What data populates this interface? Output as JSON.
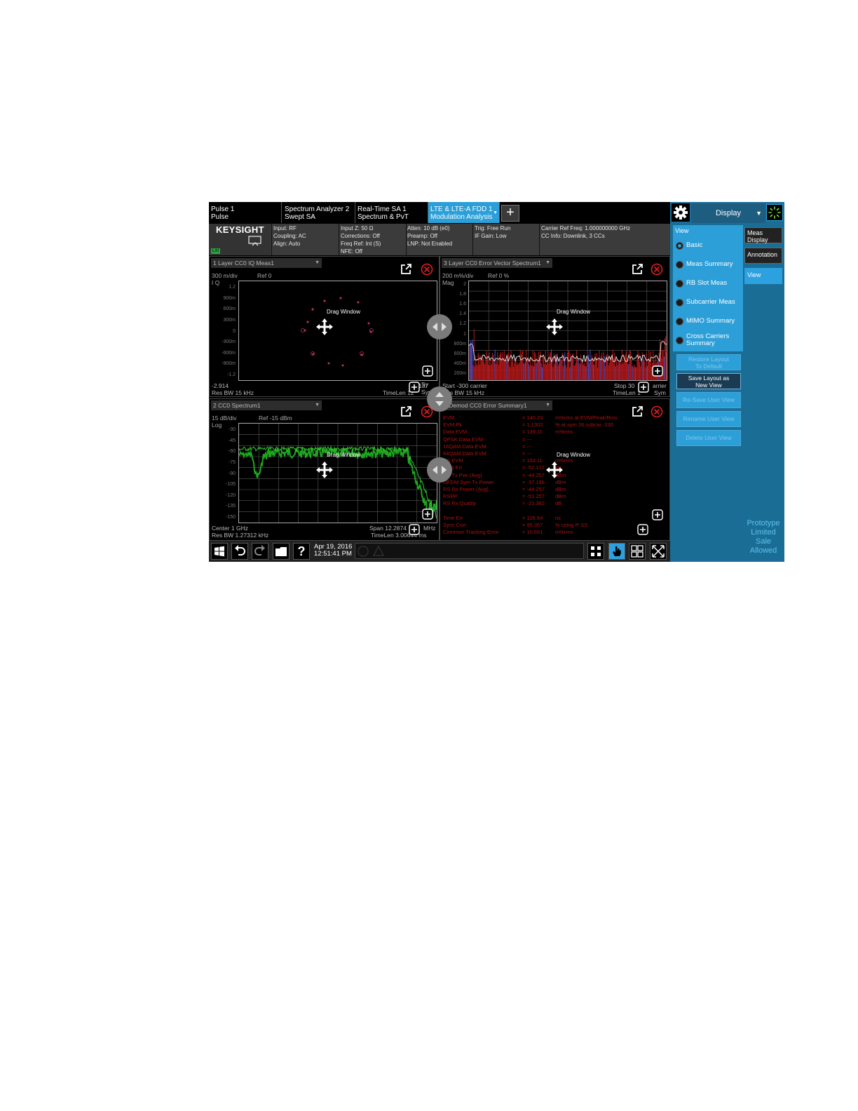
{
  "tabs": [
    {
      "line1": "Pulse 1",
      "line2": "Pulse"
    },
    {
      "line1": "Spectrum Analyzer 2",
      "line2": "Swept SA"
    },
    {
      "line1": "Real-Time SA 1",
      "line2": "Spectrum & PvT"
    },
    {
      "line1": "LTE & LTE-A FDD 1",
      "line2": "Modulation Analysis"
    }
  ],
  "add_tab_label": "+",
  "menu": {
    "label": "Display"
  },
  "brand": "KEYSIGHT",
  "lxi_badge": "LXI",
  "info": {
    "col1": [
      "Input: RF",
      "Coupling: AC",
      "Align: Auto"
    ],
    "col2": [
      "Input Z: 50 Ω",
      "Corrections: Off",
      "Freq Ref: Int (S)",
      "NFE: Off"
    ],
    "col3": [
      "Atten: 10 dB (e0)",
      "Preamp: Off",
      "LNP: Not Enabled"
    ],
    "col4": [
      "Trig: Free Run",
      "IF Gain: Low"
    ],
    "col5": [
      "Carrier Ref Freq: 1.000000000 GHz",
      "CC Info: Downlink, 3 CCs"
    ]
  },
  "drag_label": "Drag Window",
  "windows": {
    "w1": {
      "title": "1 Layer CC0 IQ Meas1",
      "scale_left": "300 m/div",
      "scale_ref": "Ref 0",
      "scale_unit": "I Q",
      "yticks": [
        "1.2",
        "900m",
        "600m",
        "300m",
        "0",
        "-300m",
        "-600m",
        "-900m",
        "-1.2"
      ],
      "foot_left1": "-2.914",
      "foot_left2": "Res BW 15 kHz",
      "foot_right1": "137",
      "foot_right2": "TimeLen 12"
    },
    "w2": {
      "title": "2 CC0 Spectrum1",
      "scale_left": "15 dB/div",
      "scale_ref": "Ref -15 dBm",
      "scale_unit": "Log",
      "yticks": [
        "-30",
        "-45",
        "-60",
        "-75",
        "-90",
        "-105",
        "-120",
        "-135",
        "-150"
      ],
      "foot_left1": "Center 1 GHz",
      "foot_left2": "Res BW 1.27312 kHz",
      "foot_right1": "Span 12.2874",
      "foot_right2": "TimeLen 3.00644 ms",
      "foot_mhz": "MHz"
    },
    "w3": {
      "title": "3 Layer CC0 Error Vector Spectrum1",
      "scale_left": "200 m%/div",
      "scale_ref": "Ref 0 %",
      "scale_unit": "Mag",
      "yticks": [
        "2",
        "1.8",
        "1.6",
        "1.4",
        "1.2",
        "1",
        "800m",
        "600m",
        "400m",
        "200m"
      ],
      "foot_left1": "Start -300 carrier",
      "foot_left2": "Res BW 15 kHz",
      "foot_right1": "Stop 30",
      "foot_right1b": "arrier",
      "foot_right2": "TimeLen 1",
      "foot_right2b": "Sym",
      "foot_mid1": "Sy",
      "foot_mid2": "Sym"
    },
    "w4": {
      "title": "4 Demod CC0 Error Summary1",
      "rows": [
        {
          "name": "EVM",
          "v": "= 140.23",
          "u": "m%rms at  EVM/Peak/Rms"
        },
        {
          "name": "EVM Pk",
          "v": "= 1.1302",
          "u": "% at  sym 26  subcar -230"
        },
        {
          "name": "Data EVM",
          "v": "= 139.11",
          "u": "m%rms"
        },
        {
          "name": "  QPSK Data EVM",
          "v": "= ---",
          "u": ""
        },
        {
          "name": "  16QAM Data EVM",
          "v": "= ---",
          "u": ""
        },
        {
          "name": "  64QAM Data EVM",
          "v": "= ---",
          "u": ""
        },
        {
          "name": "RS EVM",
          "v": "= 153.11",
          "u": "m%rms"
        },
        {
          "name": "Freq Err",
          "v": "= -52.172",
          "u": "Hz"
        },
        {
          "name": "RS Tx Pwr (Avg)",
          "v": "= -44.257",
          "u": "dBm"
        },
        {
          "name": "OFDM Sym Tx Power",
          "v": "= -37.196",
          "u": "dBm"
        },
        {
          "name": "RS Rx Power (Avg)",
          "v": "= -44.257",
          "u": "dBm"
        },
        {
          "name": "RSRP",
          "v": "= -51.257",
          "u": "dBm"
        },
        {
          "name": "RS Rx Quality",
          "v": "= -21.382",
          "u": "dB"
        },
        {
          "name": "",
          "v": "",
          "u": ""
        },
        {
          "name": "Time Err",
          "v": "= 126.54",
          "u": "ns"
        },
        {
          "name": "Sync Corr",
          "v": "= 95.357",
          "u": "%  using  P-SS"
        },
        {
          "name": "Common Tracking Error",
          "v": "= 10.651",
          "u": "m%rms"
        }
      ]
    }
  },
  "view_panel": {
    "label": "View",
    "options": [
      "Basic",
      "Meas Summary",
      "RB Slot Meas",
      "Subcarrier Meas",
      "MIMO Summary",
      "Cross Carriers Summary"
    ],
    "selected": "Basic",
    "buttons": [
      {
        "l1": "Restore Layout",
        "l2": "To Default",
        "enabled": false
      },
      {
        "l1": "Save Layout as",
        "l2": "New View",
        "enabled": true
      },
      {
        "l1": "Re-Save User View",
        "l2": "",
        "enabled": false
      },
      {
        "l1": "Rename User View",
        "l2": "",
        "enabled": false
      },
      {
        "l1": "Delete User View",
        "l2": "",
        "enabled": false
      }
    ]
  },
  "side_tabs": [
    {
      "l1": "Meas",
      "l2": "Display"
    },
    {
      "l1": "Annotation",
      "l2": ""
    },
    {
      "l1": "View",
      "l2": ""
    }
  ],
  "prototype": [
    "Prototype",
    "Limited",
    "Sale",
    "Allowed"
  ],
  "taskbar": {
    "date": "Apr 19, 2016",
    "time": "12:51:41 PM",
    "help": "?"
  },
  "colors": {
    "accent": "#2a9fd8",
    "spectrum": "#1fa51f",
    "error": "#b01010",
    "panel": "#1a6e96"
  }
}
